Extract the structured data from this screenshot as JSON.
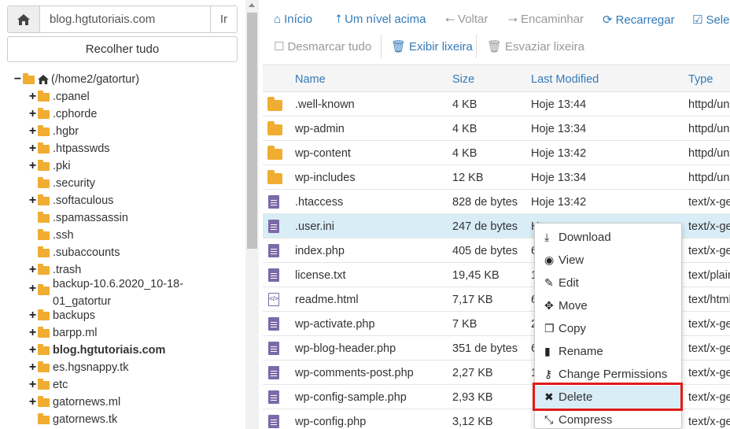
{
  "left": {
    "path_value": "blog.hgtutoriais.com",
    "go_label": "Ir",
    "collapse_label": "Recolher tudo",
    "tree": [
      {
        "label": "(/home2/gatortur)",
        "toggle": "−",
        "type": "root",
        "indent": 0
      },
      {
        "label": ".cpanel",
        "toggle": "+",
        "indent": 1
      },
      {
        "label": ".cphorde",
        "toggle": "+",
        "indent": 1
      },
      {
        "label": ".hgbr",
        "toggle": "+",
        "indent": 1
      },
      {
        "label": ".htpasswds",
        "toggle": "+",
        "indent": 1
      },
      {
        "label": ".pki",
        "toggle": "+",
        "indent": 1
      },
      {
        "label": ".security",
        "toggle": "",
        "indent": 1
      },
      {
        "label": ".softaculous",
        "toggle": "+",
        "indent": 1
      },
      {
        "label": ".spamassassin",
        "toggle": "",
        "indent": 1
      },
      {
        "label": ".ssh",
        "toggle": "",
        "indent": 1
      },
      {
        "label": ".subaccounts",
        "toggle": "",
        "indent": 1
      },
      {
        "label": ".trash",
        "toggle": "+",
        "indent": 1
      },
      {
        "label": "backup-10.6.2020_10-18-",
        "label2": "01_gatortur",
        "toggle": "+",
        "indent": 1
      },
      {
        "label": "backups",
        "toggle": "+",
        "indent": 1
      },
      {
        "label": "barpp.ml",
        "toggle": "+",
        "indent": 1
      },
      {
        "label": "blog.hgtutoriais.com",
        "toggle": "+",
        "indent": 1,
        "bold": true
      },
      {
        "label": "es.hgsnappy.tk",
        "toggle": "+",
        "indent": 1
      },
      {
        "label": "etc",
        "toggle": "+",
        "indent": 1
      },
      {
        "label": "gatornews.ml",
        "toggle": "+",
        "indent": 1
      },
      {
        "label": "gatornews.tk",
        "toggle": "",
        "indent": 1
      }
    ]
  },
  "toolbar": {
    "home": "Início",
    "up": "Um nível acima",
    "back": "Voltar",
    "forward": "Encaminhar",
    "reload": "Recarregar",
    "select_all": "Selec",
    "deselect_all": "Desmarcar tudo",
    "show_trash": "Exibir lixeira",
    "empty_trash": "Esvaziar lixeira"
  },
  "table": {
    "headers": {
      "name": "Name",
      "size": "Size",
      "modified": "Last Modified",
      "type": "Type"
    },
    "rows": [
      {
        "icon": "folder",
        "name": ".well-known",
        "size": "4 KB",
        "modified": "Hoje 13:44",
        "type": "httpd/uni"
      },
      {
        "icon": "folder",
        "name": "wp-admin",
        "size": "4 KB",
        "modified": "Hoje 13:34",
        "type": "httpd/uni"
      },
      {
        "icon": "folder",
        "name": "wp-content",
        "size": "4 KB",
        "modified": "Hoje 13:42",
        "type": "httpd/uni"
      },
      {
        "icon": "folder",
        "name": "wp-includes",
        "size": "12 KB",
        "modified": "Hoje 13:34",
        "type": "httpd/uni"
      },
      {
        "icon": "file",
        "name": ".htaccess",
        "size": "828 de bytes",
        "modified": "Hoje 13:42",
        "type": "text/x-ge"
      },
      {
        "icon": "file",
        "name": ".user.ini",
        "size": "247 de bytes",
        "modified": "H",
        "type": "text/x-ge",
        "selected": true
      },
      {
        "icon": "file",
        "name": "index.php",
        "size": "405 de bytes",
        "modified": "6",
        "type": "text/x-ge"
      },
      {
        "icon": "file",
        "name": "license.txt",
        "size": "19,45 KB",
        "modified": "1",
        "type": "text/plain"
      },
      {
        "icon": "html",
        "name": "readme.html",
        "size": "7,17 KB",
        "modified": "6",
        "type": "text/html"
      },
      {
        "icon": "file",
        "name": "wp-activate.php",
        "size": "7 KB",
        "modified": "2",
        "type": "text/x-ge"
      },
      {
        "icon": "file",
        "name": "wp-blog-header.php",
        "size": "351 de bytes",
        "modified": "6",
        "type": "text/x-ge"
      },
      {
        "icon": "file",
        "name": "wp-comments-post.php",
        "size": "2,27 KB",
        "modified": "1",
        "type": "text/x-ge"
      },
      {
        "icon": "file",
        "name": "wp-config-sample.php",
        "size": "2,93 KB",
        "modified": "",
        "type": "text/x-ge"
      },
      {
        "icon": "file",
        "name": "wp-config.php",
        "size": "3,12 KB",
        "modified": "",
        "type": "text/x-ge"
      }
    ]
  },
  "context_menu": [
    {
      "icon": "download-icon",
      "glyph": "⤓",
      "label": "Download"
    },
    {
      "icon": "eye-icon",
      "glyph": "◉",
      "label": "View"
    },
    {
      "icon": "pencil-icon",
      "glyph": "✎",
      "label": "Edit"
    },
    {
      "icon": "move-icon",
      "glyph": "✥",
      "label": "Move"
    },
    {
      "icon": "copy-icon",
      "glyph": "❐",
      "label": "Copy"
    },
    {
      "icon": "file-icon",
      "glyph": "▮",
      "label": "Rename"
    },
    {
      "icon": "key-icon",
      "glyph": "⚷",
      "label": "Change Permissions"
    },
    {
      "icon": "x-icon",
      "glyph": "✖",
      "label": "Delete",
      "highlight": true
    },
    {
      "icon": "compress-icon",
      "glyph": "⤡",
      "label": "Compress"
    }
  ],
  "colors": {
    "accent": "#337ab7",
    "folder": "#f0ad32",
    "file": "#7b6aa8",
    "highlight_border": "#e01b1b",
    "selected_row": "#d9edf7"
  }
}
